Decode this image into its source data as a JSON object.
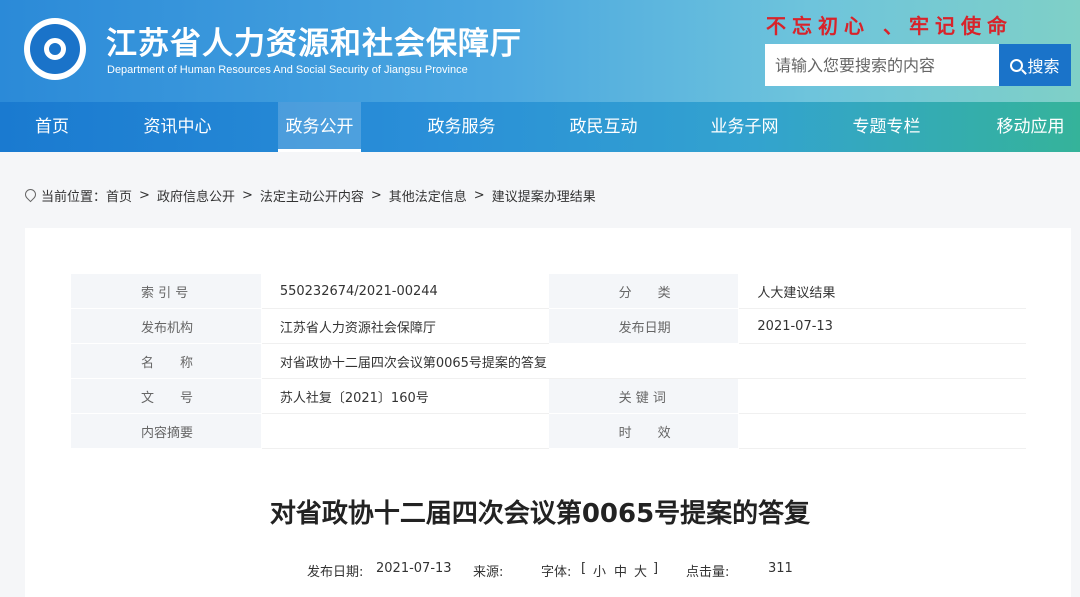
{
  "header": {
    "title": "江苏省人力资源和社会保障厅",
    "subtitle": "Department of Human Resources And Social Security of Jiangsu Province",
    "slogan": "不忘初心 、牢记使命",
    "search_placeholder": "请输入您要搜索的内容",
    "search_label": "搜索"
  },
  "nav": [
    {
      "label": "首页"
    },
    {
      "label": "资讯中心"
    },
    {
      "label": "政务公开",
      "active": true
    },
    {
      "label": "政务服务"
    },
    {
      "label": "政民互动"
    },
    {
      "label": "业务子网"
    },
    {
      "label": "专题专栏"
    },
    {
      "label": "移动应用"
    }
  ],
  "breadcrumb": {
    "prefix": "当前位置：",
    "items": [
      "首页",
      "政府信息公开",
      "法定主动公开内容",
      "其他法定信息",
      "建议提案办理结果"
    ]
  },
  "info": {
    "index_label": "索 引 号",
    "index_value": "550232674/2021-00244",
    "category_label": "分　　类",
    "category_value": "人大建议结果",
    "publisher_label": "发布机构",
    "publisher_value": "江苏省人力资源社会保障厅",
    "date_label": "发布日期",
    "date_value": "2021-07-13",
    "name_label": "名　　称",
    "name_value": "对省政协十二届四次会议第0065号提案的答复",
    "doc_label": "文　　号",
    "doc_value": "苏人社复〔2021〕160号",
    "keyword_label": "关 键 词",
    "keyword_value": "",
    "summary_label": "内容摘要",
    "summary_value": "",
    "validity_label": "时　　效",
    "validity_value": ""
  },
  "article": {
    "title": "对省政协十二届四次会议第0065号提案的答复",
    "date_label": "发布日期:",
    "date_value": "2021-07-13",
    "source_label": "来源:",
    "font_label": "字体:",
    "font_bracket_open": "[",
    "font_small": "小",
    "font_medium": "中",
    "font_large": "大",
    "font_bracket_close": "]",
    "views_label": "点击量:",
    "views_value": "311"
  }
}
